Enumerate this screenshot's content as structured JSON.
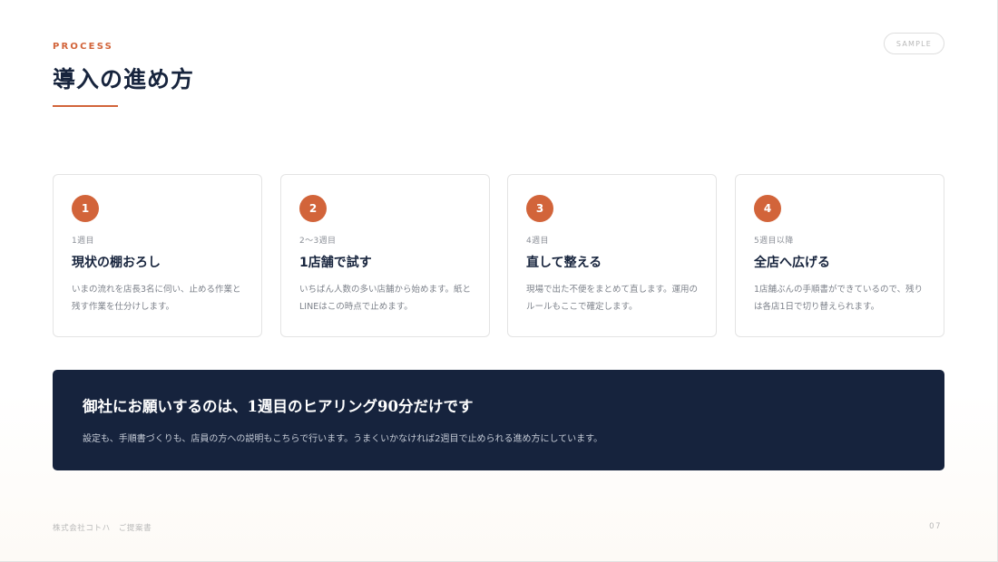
{
  "header": {
    "eyebrow": "PROCESS",
    "title": "導入の進め方",
    "badge": "SAMPLE"
  },
  "steps": [
    {
      "number": "1",
      "period": "1週目",
      "title": "現状の棚おろし",
      "description": "いまの流れを店長3名に伺い、止める作業と残す作業を仕分けします。"
    },
    {
      "number": "2",
      "period": "2〜3週目",
      "title": "1店舗で試す",
      "description": "いちばん人数の多い店舗から始めます。紙とLINEはこの時点で止めます。"
    },
    {
      "number": "3",
      "period": "4週目",
      "title": "直して整える",
      "description": "現場で出た不便をまとめて直します。運用のルールもここで確定します。"
    },
    {
      "number": "4",
      "period": "5週目以降",
      "title": "全店へ広げる",
      "description": "1店舗ぶんの手順書ができているので、残りは各店1日で切り替えられます。"
    }
  ],
  "callout": {
    "heading": "御社にお願いするのは、1週目のヒアリング90分だけです",
    "body": "設定も、手順書づくりも、店員の方への説明もこちらで行います。うまくいかなければ2週目で止められる進め方にしています。"
  },
  "footer": {
    "left": "株式会社コトハ　ご提案書",
    "page": "07"
  },
  "colors": {
    "accent": "#d2643a",
    "navy": "#16233d"
  }
}
